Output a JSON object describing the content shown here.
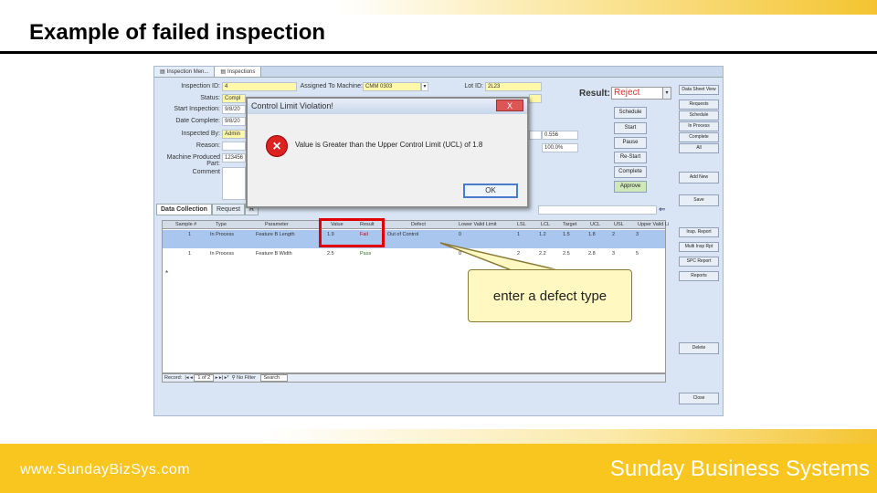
{
  "slide": {
    "title": "Example of failed inspection",
    "footer_url": "www.SundayBizSys.com",
    "footer_brand": "Sunday Business Systems"
  },
  "app": {
    "tabs": [
      {
        "label": "Inspection Men..."
      },
      {
        "label": "Inspections"
      }
    ],
    "fields": {
      "inspection_id": {
        "label": "Inspection ID:",
        "value": "4"
      },
      "status": {
        "label": "Status:",
        "value": "Compl"
      },
      "start_inspection": {
        "label": "Start Inspection:",
        "value": "9/8/20"
      },
      "date_complete": {
        "label": "Date Complete:",
        "value": "9/8/20"
      },
      "inspected_by": {
        "label": "Inspected By:",
        "value": "Admin"
      },
      "reason": {
        "label": "Reason:",
        "value": ""
      },
      "machine_produced_part": {
        "label": "Machine Produced Part:",
        "value": "123456"
      },
      "comment": {
        "label": "Comment",
        "value": ""
      },
      "assigned_to_machine": {
        "label": "Assigned To Machine:",
        "value": "CMM 0303"
      },
      "lot_id": {
        "label": "Lot ID:",
        "value": "2L23"
      },
      "side_value_1": "0.556",
      "side_value_2": "100.0%"
    },
    "result": {
      "label": "Result:",
      "value": "Reject"
    },
    "mid_buttons": [
      "Schedule",
      "Start",
      "Pause",
      "Re-Start",
      "Complete",
      "Approve"
    ],
    "side_buttons_top": [
      "Data Sheet View",
      "Requests",
      "Schedule",
      "In Process",
      "Complete",
      "All"
    ],
    "side_buttons_mid": [
      "Add New",
      "Save"
    ],
    "side_buttons_low": [
      "Insp. Report",
      "Multi Insp Rpt",
      "SPC Report",
      "Reports"
    ],
    "side_button_delete": "Delete",
    "side_button_close": "Close",
    "subtabs": [
      {
        "label": "Data Collection"
      },
      {
        "label": "Request"
      },
      {
        "label": "R"
      }
    ],
    "grid": {
      "headers": [
        "Sample #",
        "Type",
        "Parameter",
        "Value",
        "Result",
        "Defect",
        "Lower Valid Limit",
        "LSL",
        "LCL",
        "Target",
        "UCL",
        "USL",
        "Upper Valid Limit"
      ],
      "rows": [
        {
          "sample": "1",
          "type": "In Process",
          "parameter": "Feature B Length",
          "value": "1.9",
          "result": "Fail",
          "defect": "Out of Control",
          "lvl": "0",
          "lsl": "1",
          "lcl": "1.2",
          "target": "1.5",
          "ucl": "1.8",
          "usl": "2",
          "uvl": "3"
        },
        {
          "sample": "1",
          "type": "In Process",
          "parameter": "Feature B Width",
          "value": "2.5",
          "result": "Pass",
          "defect": "",
          "lvl": "0",
          "lsl": "2",
          "lcl": "2.2",
          "target": "2.5",
          "ucl": "2.8",
          "usl": "3",
          "uvl": "5"
        }
      ],
      "new_row_marker": "*"
    },
    "navbar": {
      "record_label": "Record:",
      "record_value": "1 of 2",
      "filter": "No Filter",
      "search": "Search"
    }
  },
  "dialog": {
    "title": "Control Limit Violation!",
    "close": "X",
    "message": "Value is Greater than the Upper Control Limit (UCL) of 1.8",
    "ok": "OK"
  },
  "callout": {
    "text": "enter a defect type"
  },
  "colors": {
    "accent_yellow": "#f8c61f",
    "reject_red": "#e03030",
    "highlight_red": "#e00000"
  }
}
